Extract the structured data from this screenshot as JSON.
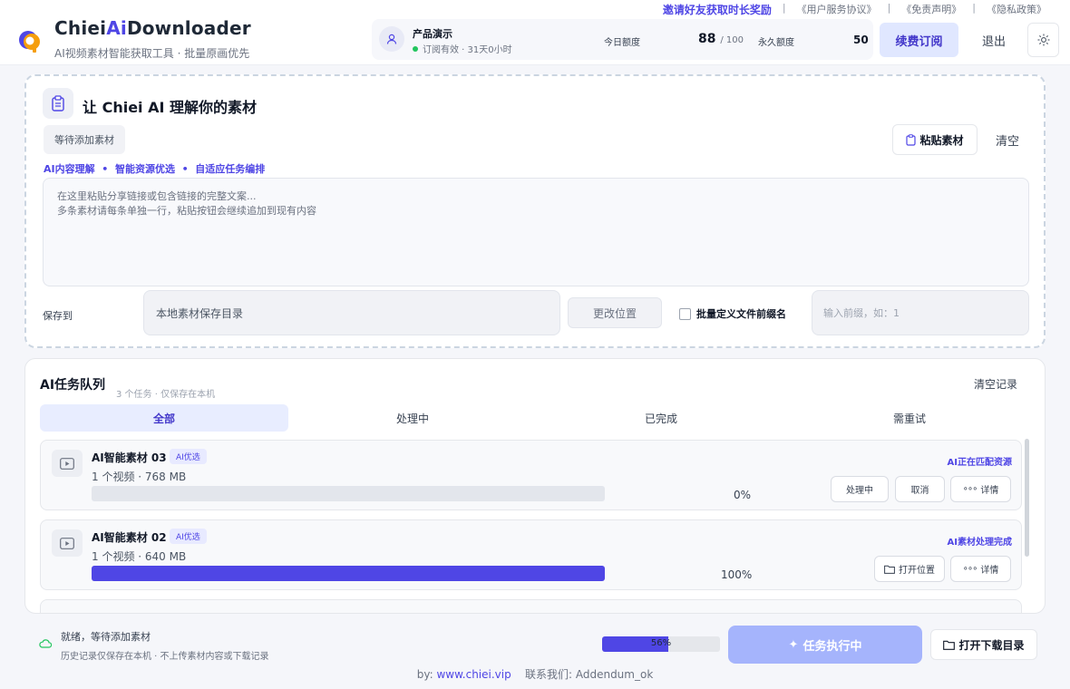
{
  "brand": {
    "name_pre": "Chiei",
    "name_ai": "Ai",
    "name_post": "Downloader",
    "subtitle": "AI视频素材智能获取工具 · 批量原画优先"
  },
  "toplinks": {
    "invite": "邀请好友获取时长奖励",
    "terms": "《用户服务协议》",
    "disclaimer": "《免责声明》",
    "privacy": "《隐私政策》",
    "sep": "|"
  },
  "user": {
    "name": "产品演示",
    "status": "订阅有效 · 31天0小时",
    "today_label": "今日额度",
    "today_value": "88",
    "today_total": "/ 100",
    "perm_label": "永久额度",
    "perm_value": "50"
  },
  "header_buttons": {
    "renew": "续费订阅",
    "logout": "退出"
  },
  "input_panel": {
    "title": "让 Chiei AI 理解你的素材",
    "pending": "等待添加素材",
    "features": "AI内容理解  •  智能资源优选  •  自适应任务编排",
    "paste": "粘贴素材",
    "clear": "清空",
    "textarea_placeholder": "在这里粘贴分享链接或包含链接的完整文案...\n多条素材请每条单独一行，粘贴按钮会继续追加到现有内容",
    "save_label": "保存到",
    "save_path": "本地素材保存目录",
    "change_location": "更改位置",
    "batch_prefix_label": "批量定义文件前缀名",
    "prefix_placeholder": "输入前缀，如：1"
  },
  "queue": {
    "title": "AI任务队列",
    "subtitle": "3 个任务 · 仅保存在本机",
    "clear_records": "清空记录",
    "tabs": [
      "全部",
      "处理中",
      "已完成",
      "需重试"
    ],
    "tasks": [
      {
        "name": "AI智能素材 03",
        "badge": "AI优选",
        "meta": "1 个视频 · 768 MB",
        "progress": 0,
        "progress_text": "0%",
        "status": "AI正在匹配资源",
        "buttons": [
          "处理中",
          "取消",
          "详情"
        ]
      },
      {
        "name": "AI智能素材 02",
        "badge": "AI优选",
        "meta": "1 个视频 · 640 MB",
        "progress": 100,
        "progress_text": "100%",
        "status": "AI素材处理完成",
        "buttons": [
          "打开位置",
          "详情"
        ]
      }
    ]
  },
  "footer": {
    "status_main": "就绪，等待添加素材",
    "status_sub": "历史记录仅保存在本机 · 不上传素材内容或下载记录",
    "progress": 56,
    "progress_text": "56%",
    "run_button": "任务执行中",
    "open_dir": "打开下载目录",
    "by_label": "by:",
    "site": "www.chiei.vip",
    "contact": "联系我们: Addendum_ok"
  },
  "colors": {
    "accent": "#4f46e5",
    "accent_light": "#a5b4fc",
    "success": "#22c55e"
  }
}
